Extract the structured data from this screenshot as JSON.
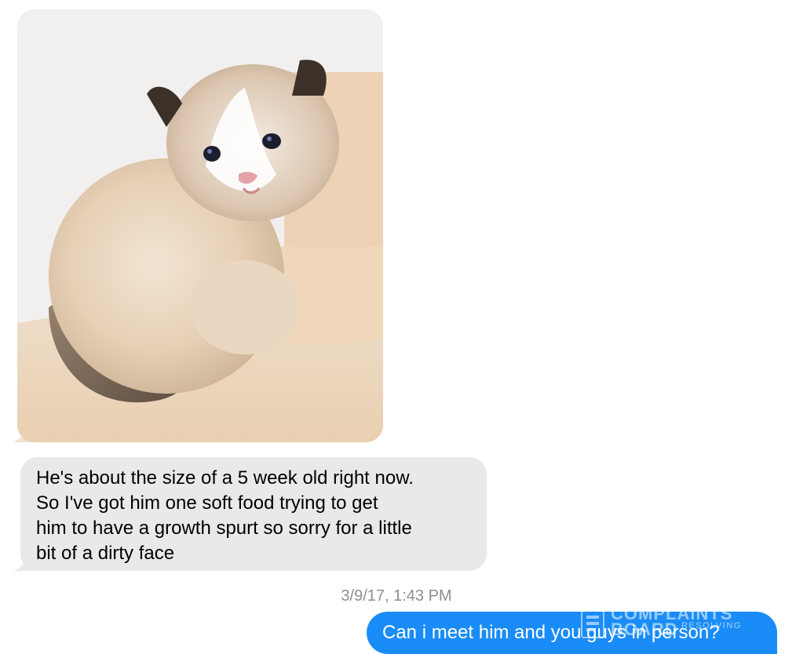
{
  "messages": {
    "image_message": {
      "image": "kitten-photo",
      "sender": "incoming"
    },
    "incoming_text": {
      "lines": [
        "He's about the size of a 5 week old right now.",
        "So I've got him one soft food trying to get",
        "him to have a growth spurt so sorry for a little",
        "bit of a dirty face"
      ],
      "sender": "incoming"
    },
    "timestamp": "3/9/17, 1:43 PM",
    "outgoing_text": {
      "text": "Can i meet him and you guys in person?",
      "sender": "outgoing"
    }
  },
  "watermark": {
    "line1": "COMPLAINTS",
    "line2": "BOARD",
    "line3": "RESOLVING"
  },
  "colors": {
    "incoming_bubble": "#e9e9eb",
    "outgoing_bubble": "#1a8cf8",
    "timestamp": "#8e8e93"
  }
}
